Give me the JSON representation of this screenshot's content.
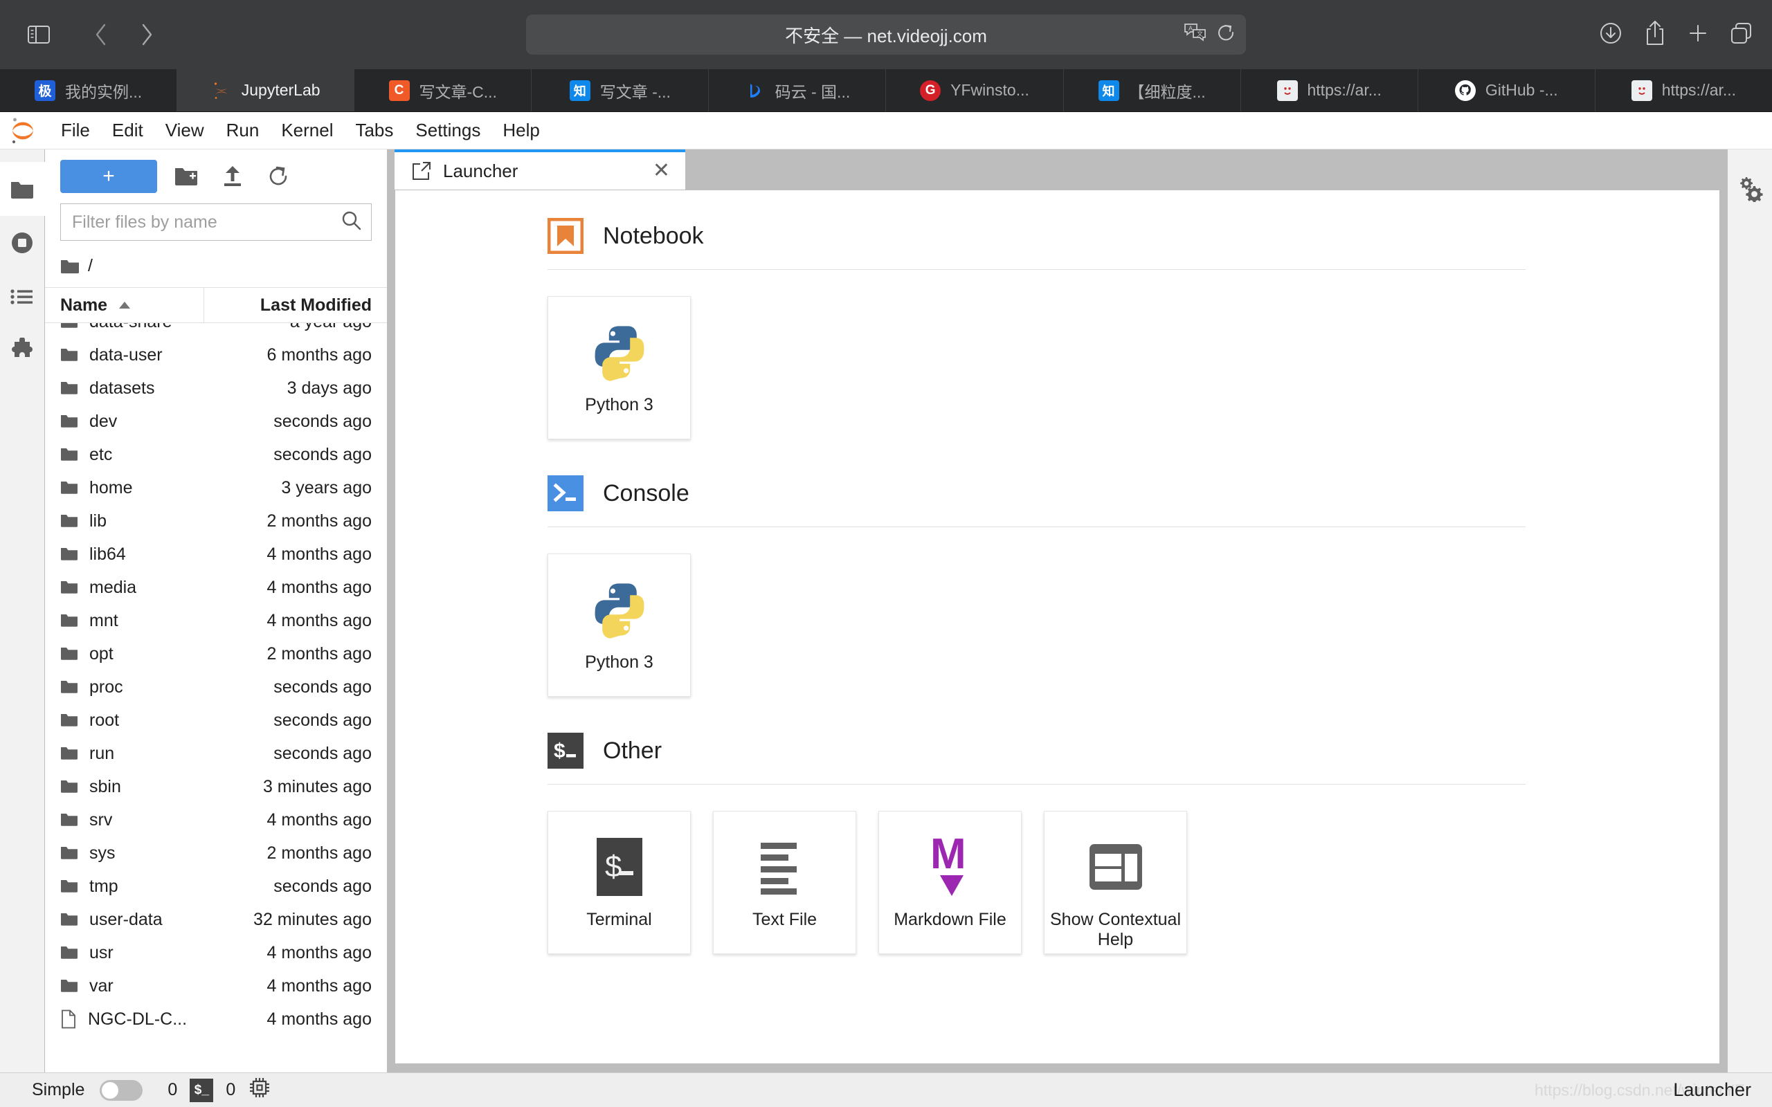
{
  "browser": {
    "url_text": "不安全 — net.videojj.com",
    "toolbar_icons": [
      {
        "name": "sidebar-toggle-icon",
        "glyph": "sidebar"
      },
      {
        "name": "back-icon",
        "glyph": "chevron-left"
      },
      {
        "name": "forward-icon",
        "glyph": "chevron-right"
      },
      {
        "name": "shield-icon",
        "glyph": "shield"
      },
      {
        "name": "translate-icon",
        "glyph": "translate"
      },
      {
        "name": "reload-icon",
        "glyph": "reload"
      },
      {
        "name": "downloads-icon",
        "glyph": "download-circle"
      },
      {
        "name": "share-icon",
        "glyph": "share"
      },
      {
        "name": "new-tab-icon",
        "glyph": "plus"
      },
      {
        "name": "tab-overview-icon",
        "glyph": "copy"
      }
    ],
    "tabs": [
      {
        "title": "我的实例...",
        "favicon_text": "极",
        "favicon_bg": "#1f5fd8",
        "active": false
      },
      {
        "title": "JupyterLab",
        "favicon_text": "",
        "favicon_bg": "transparent",
        "active": true
      },
      {
        "title": "写文章-C...",
        "favicon_text": "C",
        "favicon_bg": "#f05a28",
        "active": false
      },
      {
        "title": "写文章 -...",
        "favicon_text": "知",
        "favicon_bg": "#0f88eb",
        "active": false
      },
      {
        "title": "码云 - 国...",
        "favicon_text": "",
        "favicon_bg": "transparent",
        "active": false
      },
      {
        "title": "YFwinsto...",
        "favicon_text": "G",
        "favicon_bg": "#d32029",
        "active": false
      },
      {
        "title": "【细粒度...",
        "favicon_text": "知",
        "favicon_bg": "#0f88eb",
        "active": false
      },
      {
        "title": "https://ar...",
        "favicon_text": "",
        "favicon_bg": "#f2f2f2",
        "active": false
      },
      {
        "title": "GitHub -...",
        "favicon_text": "",
        "favicon_bg": "#ffffff",
        "active": false
      },
      {
        "title": "https://ar...",
        "favicon_text": "",
        "favicon_bg": "#f2f2f2",
        "active": false
      }
    ]
  },
  "jupyter": {
    "menubar": [
      "File",
      "Edit",
      "View",
      "Run",
      "Kernel",
      "Tabs",
      "Settings",
      "Help"
    ],
    "left_sidebar": [
      {
        "name": "file-browser",
        "icon": "folder-icon",
        "active": true
      },
      {
        "name": "running-terminals-kernels",
        "icon": "stop-circle-icon",
        "active": false
      },
      {
        "name": "commands",
        "icon": "list-icon",
        "active": false
      },
      {
        "name": "extension-manager",
        "icon": "puzzle-icon",
        "active": false
      }
    ],
    "right_sidebar": [
      {
        "name": "property-inspector",
        "icon": "gears-icon",
        "active": false
      }
    ],
    "file_browser": {
      "new_launcher_label": "+",
      "toolbar_icons": [
        "new-folder-icon",
        "upload-icon",
        "refresh-icon"
      ],
      "filter_placeholder": "Filter files by name",
      "filter_value": "",
      "breadcrumb": "/",
      "columns": {
        "name": "Name",
        "last_modified": "Last Modified"
      },
      "sort_direction": "ascending",
      "items": [
        {
          "name": "data-share",
          "modified": "a year ago",
          "type": "folder"
        },
        {
          "name": "data-user",
          "modified": "6 months ago",
          "type": "folder"
        },
        {
          "name": "datasets",
          "modified": "3 days ago",
          "type": "folder"
        },
        {
          "name": "dev",
          "modified": "seconds ago",
          "type": "folder"
        },
        {
          "name": "etc",
          "modified": "seconds ago",
          "type": "folder"
        },
        {
          "name": "home",
          "modified": "3 years ago",
          "type": "folder"
        },
        {
          "name": "lib",
          "modified": "2 months ago",
          "type": "folder"
        },
        {
          "name": "lib64",
          "modified": "4 months ago",
          "type": "folder"
        },
        {
          "name": "media",
          "modified": "4 months ago",
          "type": "folder"
        },
        {
          "name": "mnt",
          "modified": "4 months ago",
          "type": "folder"
        },
        {
          "name": "opt",
          "modified": "2 months ago",
          "type": "folder"
        },
        {
          "name": "proc",
          "modified": "seconds ago",
          "type": "folder"
        },
        {
          "name": "root",
          "modified": "seconds ago",
          "type": "folder"
        },
        {
          "name": "run",
          "modified": "seconds ago",
          "type": "folder"
        },
        {
          "name": "sbin",
          "modified": "3 minutes ago",
          "type": "folder"
        },
        {
          "name": "srv",
          "modified": "4 months ago",
          "type": "folder"
        },
        {
          "name": "sys",
          "modified": "2 months ago",
          "type": "folder"
        },
        {
          "name": "tmp",
          "modified": "seconds ago",
          "type": "folder"
        },
        {
          "name": "user-data",
          "modified": "32 minutes ago",
          "type": "folder"
        },
        {
          "name": "usr",
          "modified": "4 months ago",
          "type": "folder"
        },
        {
          "name": "var",
          "modified": "4 months ago",
          "type": "folder"
        },
        {
          "name": "NGC-DL-C...",
          "modified": "4 months ago",
          "type": "file"
        }
      ]
    },
    "dock": {
      "tab_label": "Launcher"
    },
    "launcher": {
      "sections": [
        {
          "title": "Notebook",
          "icon": "notebook-bookmark-icon",
          "cards": [
            {
              "label": "Python 3",
              "icon": "python-logo-icon"
            }
          ]
        },
        {
          "title": "Console",
          "icon": "console-prompt-icon",
          "cards": [
            {
              "label": "Python 3",
              "icon": "python-logo-icon"
            }
          ]
        },
        {
          "title": "Other",
          "icon": "terminal-dollar-icon",
          "cards": [
            {
              "label": "Terminal",
              "icon": "terminal-icon"
            },
            {
              "label": "Text File",
              "icon": "text-file-icon"
            },
            {
              "label": "Markdown File",
              "icon": "markdown-icon"
            },
            {
              "label": "Show Contextual Help",
              "icon": "contextual-help-icon"
            }
          ]
        }
      ]
    },
    "statusbar": {
      "simple_label": "Simple",
      "simple_enabled": false,
      "kernel_count": "0",
      "terminal_badge": "$_",
      "terminal_count": "0",
      "resource_icon": "cpu-icon",
      "active_widget": "Launcher",
      "watermark": "https://blog.csdn.net/winterYF"
    }
  },
  "colors": {
    "accent_blue": "#2196f3",
    "new_button_blue": "#4a90e2",
    "jupyter_orange": "#f37726",
    "markdown_purple": "#9c27b0",
    "console_blue": "#4a90e2",
    "dark_gray": "#424242"
  }
}
